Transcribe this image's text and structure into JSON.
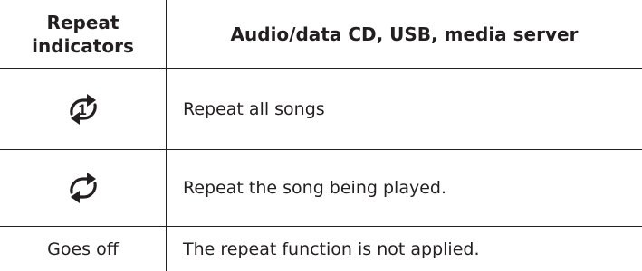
{
  "table": {
    "header": {
      "indicators_line1": "Repeat",
      "indicators_line2": "indicators",
      "sources": "Audio/data CD, USB, media server"
    },
    "rows": [
      {
        "indicator_icon": "repeat-one-icon",
        "indicator_icon_digit": "1",
        "description": "Repeat all songs"
      },
      {
        "indicator_icon": "repeat-icon",
        "description": "Repeat the song being played."
      },
      {
        "indicator_text": "Goes off",
        "description": "The repeat function is not applied."
      }
    ]
  }
}
